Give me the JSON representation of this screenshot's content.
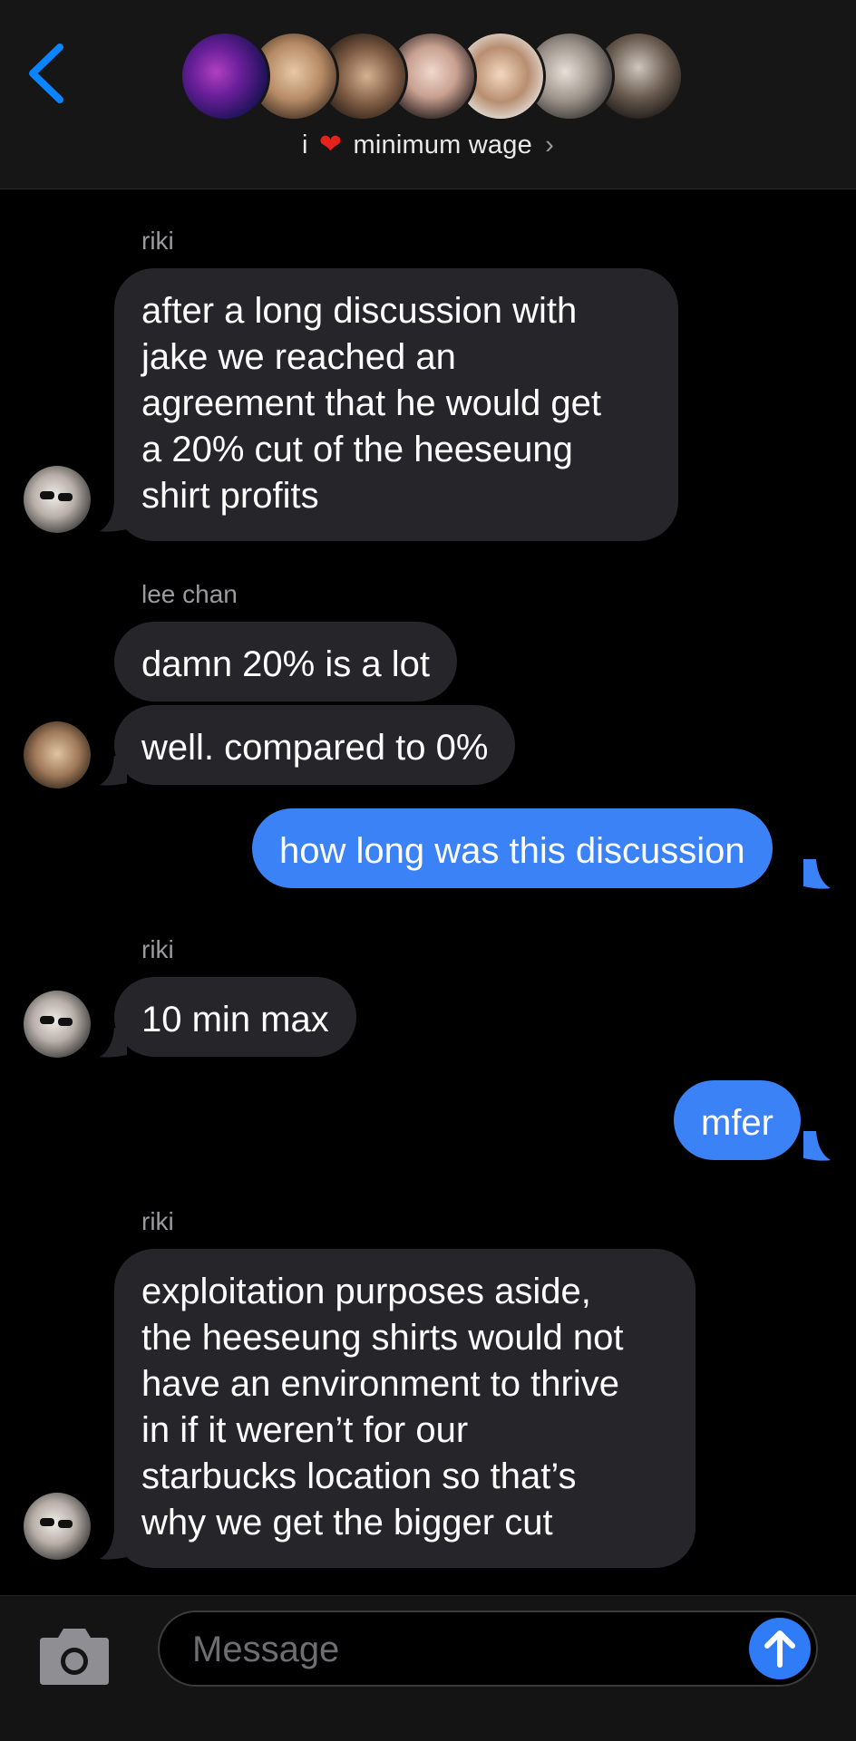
{
  "header": {
    "prefix": "i",
    "heart": "❤",
    "name": "minimum wage",
    "chevron": "›",
    "back_icon": "chevron-left-icon",
    "avatar_count": 7
  },
  "messages": [
    {
      "sender": "riki",
      "lines": [
        "after a long discussion with",
        "jake we reached an",
        "agreement that he would get",
        "a 20% cut of the heeseung",
        "shirt profits"
      ]
    },
    {
      "sender": "lee chan",
      "lines": [
        "damn 20% is a lot"
      ]
    },
    {
      "lines": [
        "well. compared to 0%"
      ]
    },
    {
      "lines": [
        "how long was this discussion"
      ]
    },
    {
      "sender": "riki",
      "lines": [
        "10 min max"
      ]
    },
    {
      "lines": [
        "mfer"
      ]
    },
    {
      "sender": "riki",
      "lines": [
        "exploitation purposes aside,",
        "the heeseung shirts would not",
        "have an environment to thrive",
        "in if it weren’t for our",
        "starbucks location so that’s",
        "why we get the bigger cut"
      ]
    }
  ],
  "input": {
    "placeholder": "Message",
    "camera_icon": "camera-icon",
    "send_icon": "arrow-up-icon"
  },
  "colors": {
    "incoming_bubble": "#26252a",
    "outgoing_bubble": "#3b82f6",
    "accent": "#0a84ff"
  }
}
